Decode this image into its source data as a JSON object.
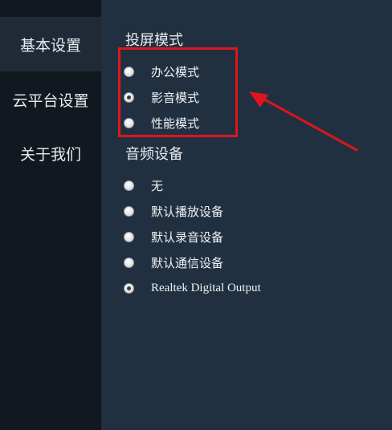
{
  "sidebar": {
    "items": [
      {
        "label": "基本设置",
        "active": true
      },
      {
        "label": "云平台设置",
        "active": false
      },
      {
        "label": "关于我们",
        "active": false
      }
    ]
  },
  "cast_mode": {
    "title": "投屏模式",
    "options": [
      {
        "label": "办公模式",
        "checked": false
      },
      {
        "label": "影音模式",
        "checked": true
      },
      {
        "label": "性能模式",
        "checked": false
      }
    ]
  },
  "audio_device": {
    "title": "音频设备",
    "options": [
      {
        "label": "无",
        "checked": false
      },
      {
        "label": "默认播放设备",
        "checked": false
      },
      {
        "label": "默认录音设备",
        "checked": false
      },
      {
        "label": "默认通信设备",
        "checked": false
      },
      {
        "label": "Realtek Digital Output",
        "checked": true
      }
    ]
  },
  "annotation": {
    "color": "#e0141c"
  }
}
